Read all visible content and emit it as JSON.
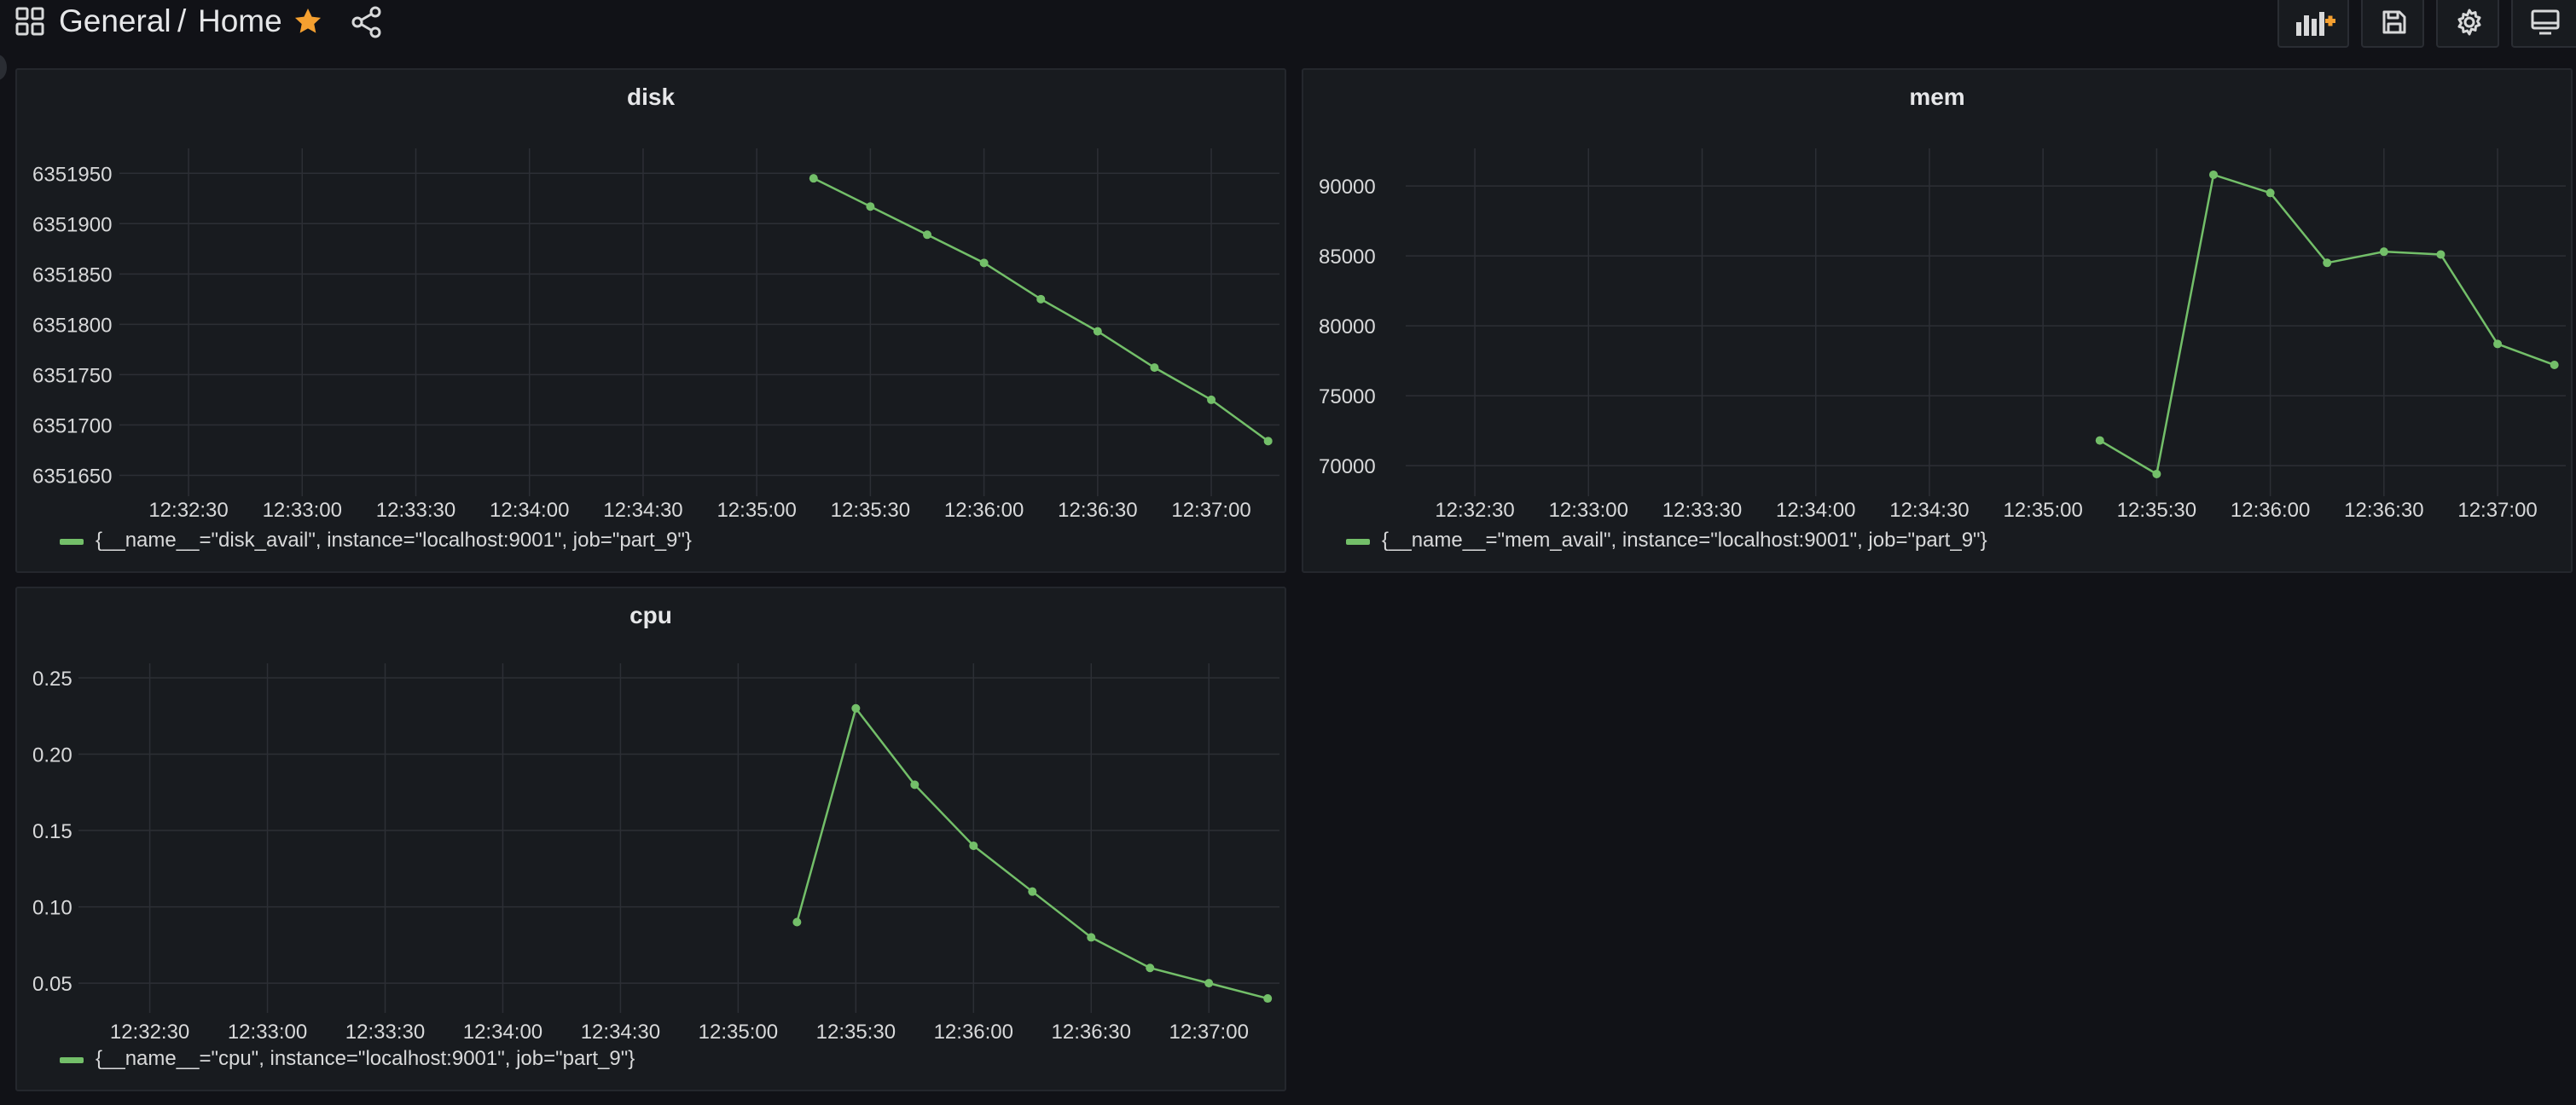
{
  "header": {
    "folder": "General",
    "separator": "/",
    "dashboard_title": "Home",
    "starred": true,
    "accent_color": "#f5a030",
    "icons": [
      "apps-grid-icon",
      "star-icon",
      "share-icon",
      "add-panel-icon",
      "save-icon",
      "gear-icon",
      "tv-mode-icon"
    ]
  },
  "panels": {
    "disk": {
      "title": "disk",
      "legend": "{__name__=\"disk_avail\", instance=\"localhost:9001\", job=\"part_9\"}"
    },
    "mem": {
      "title": "mem",
      "legend": "{__name__=\"mem_avail\", instance=\"localhost:9001\", job=\"part_9\"}"
    },
    "cpu": {
      "title": "cpu",
      "legend": "{__name__=\"cpu\", instance=\"localhost:9001\", job=\"part_9\"}"
    }
  },
  "chart_data": [
    {
      "id": "disk",
      "type": "line",
      "title": "disk",
      "series_color": "#73bf69",
      "xticks": [
        "12:32:30",
        "12:33:00",
        "12:33:30",
        "12:34:00",
        "12:34:30",
        "12:35:00",
        "12:35:30",
        "12:36:00",
        "12:36:30",
        "12:37:00"
      ],
      "yticks": [
        6351950,
        6351900,
        6351850,
        6351800,
        6351750,
        6351700,
        6351650
      ],
      "ylim": [
        6351650,
        6351950
      ],
      "grid": true,
      "legend_position": "bottom-left",
      "series": [
        {
          "name": "{__name__=\"disk_avail\", instance=\"localhost:9001\", job=\"part_9\"}",
          "x": [
            "12:35:15",
            "12:35:30",
            "12:35:45",
            "12:36:00",
            "12:36:15",
            "12:36:30",
            "12:36:45",
            "12:37:00",
            "12:37:15"
          ],
          "values": [
            6351945,
            6351917,
            6351889,
            6351861,
            6351825,
            6351793,
            6351757,
            6351725,
            6351684
          ]
        }
      ]
    },
    {
      "id": "mem",
      "type": "line",
      "title": "mem",
      "series_color": "#73bf69",
      "xticks": [
        "12:32:30",
        "12:33:00",
        "12:33:30",
        "12:34:00",
        "12:34:30",
        "12:35:00",
        "12:35:30",
        "12:36:00",
        "12:36:30",
        "12:37:00"
      ],
      "yticks": [
        90000,
        85000,
        80000,
        75000,
        70000
      ],
      "ylim": [
        70000,
        90000
      ],
      "grid": true,
      "legend_position": "bottom-left",
      "series": [
        {
          "name": "{__name__=\"mem_avail\", instance=\"localhost:9001\", job=\"part_9\"}",
          "x": [
            "12:35:15",
            "12:35:30",
            "12:35:45",
            "12:36:00",
            "12:36:15",
            "12:36:30",
            "12:36:45",
            "12:37:00",
            "12:37:15"
          ],
          "values": [
            71800,
            69400,
            90800,
            89500,
            84500,
            85300,
            85100,
            78700,
            77200
          ]
        }
      ]
    },
    {
      "id": "cpu",
      "type": "line",
      "title": "cpu",
      "series_color": "#73bf69",
      "xticks": [
        "12:32:30",
        "12:33:00",
        "12:33:30",
        "12:34:00",
        "12:34:30",
        "12:35:00",
        "12:35:30",
        "12:36:00",
        "12:36:30",
        "12:37:00"
      ],
      "yticks": [
        0.25,
        0.2,
        0.15,
        0.1,
        0.05
      ],
      "ylim": [
        0.05,
        0.25
      ],
      "grid": true,
      "legend_position": "bottom-left",
      "series": [
        {
          "name": "{__name__=\"cpu\", instance=\"localhost:9001\", job=\"part_9\"}",
          "x": [
            "12:35:15",
            "12:35:30",
            "12:35:45",
            "12:36:00",
            "12:36:15",
            "12:36:30",
            "12:36:45",
            "12:37:00",
            "12:37:15"
          ],
          "values": [
            0.09,
            0.23,
            0.18,
            0.14,
            0.11,
            0.08,
            0.06,
            0.05,
            0.04
          ]
        }
      ]
    }
  ]
}
